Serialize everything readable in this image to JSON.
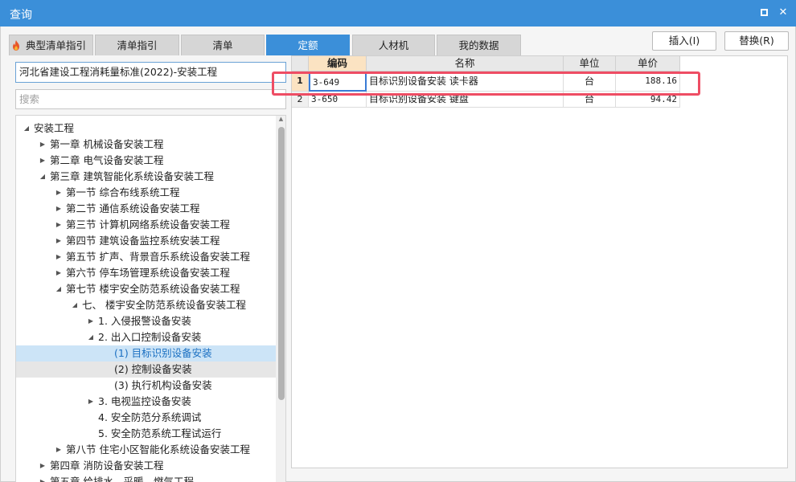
{
  "window": {
    "title": "查询",
    "maximize_label": "",
    "close_label": "✕"
  },
  "tabs": [
    {
      "label": "典型清单指引",
      "active": false
    },
    {
      "label": "清单指引",
      "active": false
    },
    {
      "label": "清单",
      "active": false
    },
    {
      "label": "定额",
      "active": true
    },
    {
      "label": "人材机",
      "active": false
    },
    {
      "label": "我的数据",
      "active": false
    }
  ],
  "actions": {
    "insert_label": "插入(I)",
    "replace_label": "替换(R)"
  },
  "library": {
    "selected": "河北省建设工程消耗量标准(2022)-安装工程"
  },
  "search": {
    "placeholder": "搜索",
    "value": ""
  },
  "tree": {
    "items": [
      {
        "label": "安装工程",
        "level": 0,
        "arrow": "expanded",
        "state": ""
      },
      {
        "label": "第一章 机械设备安装工程",
        "level": 1,
        "arrow": "collapsed",
        "state": ""
      },
      {
        "label": "第二章 电气设备安装工程",
        "level": 1,
        "arrow": "collapsed",
        "state": ""
      },
      {
        "label": "第三章 建筑智能化系统设备安装工程",
        "level": 1,
        "arrow": "expanded",
        "state": ""
      },
      {
        "label": "第一节 综合布线系统工程",
        "level": 2,
        "arrow": "collapsed",
        "state": ""
      },
      {
        "label": "第二节 通信系统设备安装工程",
        "level": 2,
        "arrow": "collapsed",
        "state": ""
      },
      {
        "label": "第三节 计算机网络系统设备安装工程",
        "level": 2,
        "arrow": "collapsed",
        "state": ""
      },
      {
        "label": "第四节 建筑设备监控系统安装工程",
        "level": 2,
        "arrow": "collapsed",
        "state": ""
      },
      {
        "label": "第五节 扩声、背景音乐系统设备安装工程",
        "level": 2,
        "arrow": "collapsed",
        "state": ""
      },
      {
        "label": "第六节 停车场管理系统设备安装工程",
        "level": 2,
        "arrow": "collapsed",
        "state": ""
      },
      {
        "label": "第七节 楼宇安全防范系统设备安装工程",
        "level": 2,
        "arrow": "expanded",
        "state": ""
      },
      {
        "label": "七、 楼宇安全防范系统设备安装工程",
        "level": 3,
        "arrow": "expanded",
        "state": ""
      },
      {
        "label": "1. 入侵报警设备安装",
        "level": 4,
        "arrow": "collapsed",
        "state": ""
      },
      {
        "label": "2. 出入口控制设备安装",
        "level": 4,
        "arrow": "expanded",
        "state": ""
      },
      {
        "label": "(1) 目标识别设备安装",
        "level": 5,
        "arrow": "none",
        "state": "selected"
      },
      {
        "label": "(2) 控制设备安装",
        "level": 5,
        "arrow": "none",
        "state": "hover"
      },
      {
        "label": "(3) 执行机构设备安装",
        "level": 5,
        "arrow": "none",
        "state": ""
      },
      {
        "label": "3. 电视监控设备安装",
        "level": 4,
        "arrow": "collapsed",
        "state": ""
      },
      {
        "label": "4. 安全防范分系统调试",
        "level": 4,
        "arrow": "none",
        "state": ""
      },
      {
        "label": "5. 安全防范系统工程试运行",
        "level": 4,
        "arrow": "none",
        "state": ""
      },
      {
        "label": "第八节 住宅小区智能化系统设备安装工程",
        "level": 2,
        "arrow": "collapsed",
        "state": ""
      },
      {
        "label": "第四章 消防设备安装工程",
        "level": 1,
        "arrow": "collapsed",
        "state": ""
      },
      {
        "label": "第五章 给排水、采暖、燃气工程",
        "level": 1,
        "arrow": "collapsed",
        "state": ""
      }
    ]
  },
  "grid": {
    "headers": {
      "code": "编码",
      "name": "名称",
      "unit": "单位",
      "price": "单价"
    },
    "rows": [
      {
        "num": "1",
        "code": "3-649",
        "name": "目标识别设备安装 读卡器",
        "unit": "台",
        "price": "188.16"
      },
      {
        "num": "2",
        "code": "3-650",
        "name": "目标识别设备安装 键盘",
        "unit": "台",
        "price": "94.42"
      }
    ]
  },
  "colors": {
    "accent": "#3b8fd9",
    "selection_bg": "#cce4f7",
    "highlight_border": "#ee4d64",
    "active_header": "#fbe3c2"
  },
  "icons": {
    "fire": "fire-icon",
    "maximize": "maximize-icon",
    "close": "close-icon"
  }
}
